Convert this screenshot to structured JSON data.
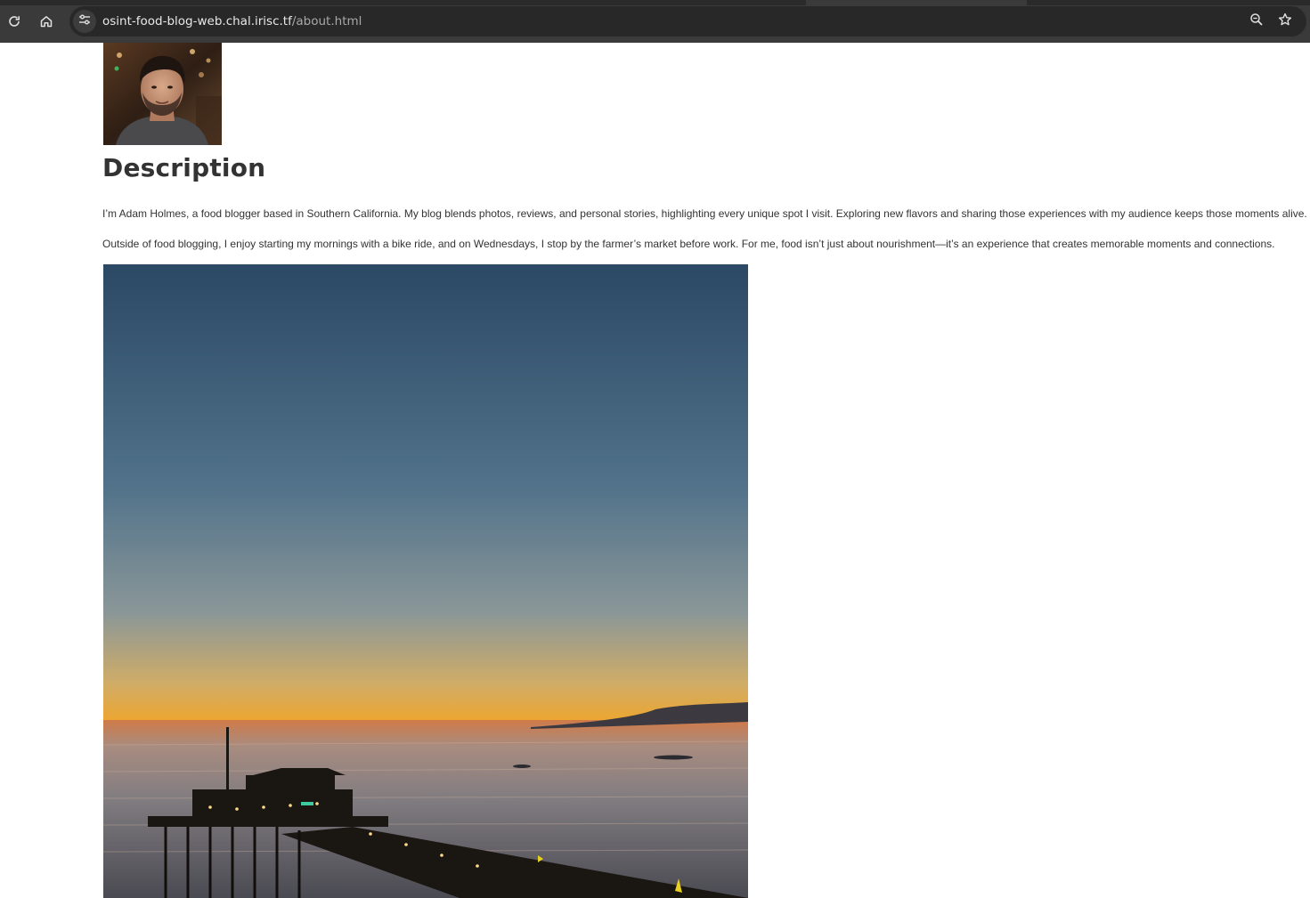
{
  "browser": {
    "url_host": "osint-food-blog-web.chal.irisc.tf",
    "url_path": "/about.html",
    "icons": [
      "reload-icon",
      "home-icon",
      "site-info-icon",
      "zoom-icon",
      "bookmark-star-icon"
    ]
  },
  "page": {
    "heading": "Description",
    "paragraphs": [
      "I’m Adam Holmes, a food blogger based in Southern California. My blog blends photos, reviews, and personal stories, highlighting every unique spot I visit. Exploring new flavors and sharing those experiences with my audience keeps those moments alive.",
      "Outside of food blogging, I enjoy starting my mornings with a bike ride, and on Wednesdays, I stop by the farmer’s market before work. For me, food isn’t just about nourishment—it’s an experience that creates memorable moments and connections."
    ]
  },
  "colors": {
    "toolbar": "#3a3a3a",
    "omnibox": "#282828",
    "text": "#333333",
    "sky_top": "#2c4a66",
    "horizon": "#f08a10"
  }
}
